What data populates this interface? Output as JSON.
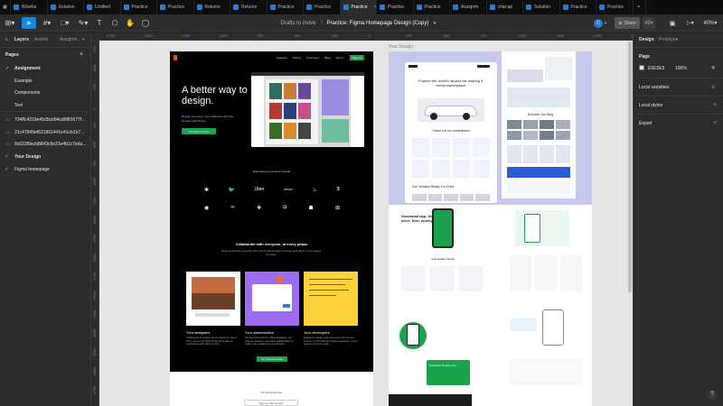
{
  "tabs": [
    {
      "label": "Wirefra",
      "active": false
    },
    {
      "label": "Solution",
      "active": false
    },
    {
      "label": "Untitled",
      "active": false
    },
    {
      "label": "Practice",
      "active": false
    },
    {
      "label": "Practice",
      "active": false
    },
    {
      "label": "Relume",
      "active": false
    },
    {
      "label": "Relume",
      "active": false
    },
    {
      "label": "Practice",
      "active": false
    },
    {
      "label": "Practice",
      "active": false
    },
    {
      "label": "Practice",
      "active": true
    },
    {
      "label": "Practice",
      "active": false
    },
    {
      "label": "Practice",
      "active": false
    },
    {
      "label": "Assignm",
      "active": false
    },
    {
      "label": "chat-ap",
      "active": false
    },
    {
      "label": "Solution",
      "active": false
    },
    {
      "label": "Practice",
      "active": false
    },
    {
      "label": "Practice",
      "active": false
    }
  ],
  "toolbar": {
    "breadcrumb_drafts": "Drafts to move",
    "breadcrumb_separator": "/",
    "file_name": "Practice: Figma Homepage Design (Copy)",
    "avatar_letter": "C",
    "share_label": "Share",
    "zoom": "40%"
  },
  "left_panel": {
    "tab_layers": "Layers",
    "tab_assets": "Assets",
    "page_switch": "Assignm...",
    "pages_header": "Pages",
    "pages": [
      "Assignment",
      "Example",
      "Components",
      "Text"
    ],
    "layers": [
      "734ffc4318e45d5cb84cd98f1677f...",
      "21c47849ef631861441e41cb1b7...",
      "8c623f9ecb8843c9e31e4b1c7eda..."
    ],
    "frames": [
      "Your Design",
      "Figma homepage"
    ]
  },
  "right_panel": {
    "tab_design": "Design",
    "tab_prototype": "Prototype",
    "page_label": "Page",
    "bg_hex": "E5E5E5",
    "bg_opacity": "100%",
    "local_variables": "Local variables",
    "local_styles": "Local styles",
    "export": "Export",
    "help": "?"
  },
  "rulers": {
    "top": [
      "-1750",
      "-1500",
      "-1250",
      "-1000",
      "-750",
      "-500",
      "-250",
      "0",
      "250",
      "500",
      "750",
      "1000",
      "1250",
      "1500",
      "1750"
    ],
    "left": [
      "-750",
      "-500",
      "-250",
      "0",
      "250",
      "500",
      "750",
      "1000",
      "1250",
      "1500",
      "1750",
      "2000",
      "2250",
      "2500",
      "2750",
      "3000",
      "3250",
      "3500",
      "3750"
    ]
  },
  "canvas": {
    "frame2_label": "Your Design",
    "hero_title": "A better way to design.",
    "hero_sub": "Design, prototype, and collaborate all in the browser with Figma.",
    "hero_cta": "Try Figma for free",
    "nav_items": [
      "Features",
      "Pricing",
      "Customers",
      "Blog",
      "Sign in",
      "Sign up"
    ],
    "trusted": "Empowering innovative brands",
    "collab_title": "Collaborate with everyone, at every phase",
    "collab_sub": "Each contributor now has their part of the creative process and stays in sync along the way.",
    "cards": [
      {
        "title": "Your designers",
        "text": "Collaborate in context and in real time. Never worry about your files being out of date or overwriting each other's work."
      },
      {
        "title": "Your stakeholders",
        "text": "Simply send a link to collect feedback, get change requests, and allow stakeholders to make copy updates in your designs."
      },
      {
        "title": "Your developers",
        "text": "Engineers always have access to the current source of truth and can inspect elements, export assets, and copy code."
      }
    ],
    "second_cta": "Try Figma for free",
    "bottom_title": "Try Figma for free",
    "bottom_button": "Sign up with Google",
    "car_title": "Explore the world's largest car sharing & rental marketplace",
    "car_checkout": "Check out our marketplace",
    "car_ready": "Our Vehicles Ready For Drive",
    "blog_title": "Discover Our Blog",
    "app_title": "Download app, Start drive, Earn money!",
    "how_title": "How Roadie Works",
    "cta_card": "Download Roadie App",
    "accent_green": "#1aa34a",
    "accent_blue": "#2b7bd6"
  }
}
